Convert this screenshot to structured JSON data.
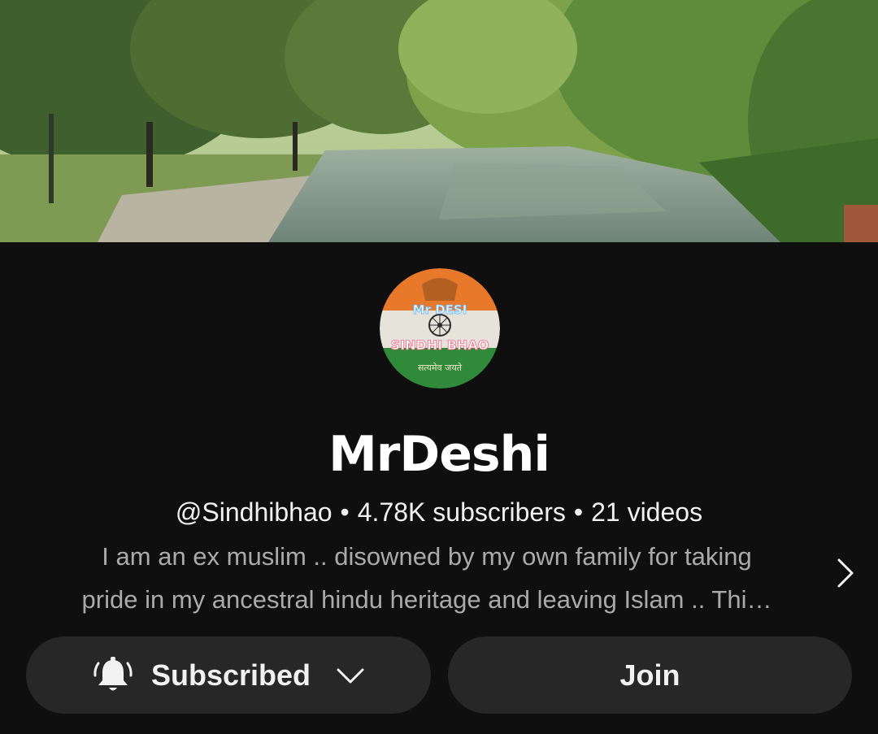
{
  "channel": {
    "name": "MrDeshi",
    "handle": "@Sindhibhao",
    "subscribers": "4.78K subscribers",
    "videos": "21 videos",
    "separator": "•",
    "description_line1": "I am an ex muslim .. disowned by my own family for taking",
    "description_line2": "pride in my ancestral hindu heritage and leaving Islam .. Thi…"
  },
  "avatar": {
    "text_top": "Mr DESI",
    "text_middle": "SINDHI BHAO",
    "text_bottom": "सत्यमेव जयते",
    "colors": {
      "saffron": "#e8782a",
      "white": "#e6e3da",
      "green": "#2f8a3a"
    }
  },
  "buttons": {
    "subscribed_label": "Subscribed",
    "join_label": "Join"
  },
  "icons": {
    "bell": "bell-icon",
    "dropdown": "chevron-down-icon",
    "expand_description": "chevron-right-icon"
  },
  "colors": {
    "background": "#0f0f0f",
    "button_bg": "#272727",
    "text_primary": "#f1f1f1",
    "text_secondary": "#aaaaaa"
  }
}
